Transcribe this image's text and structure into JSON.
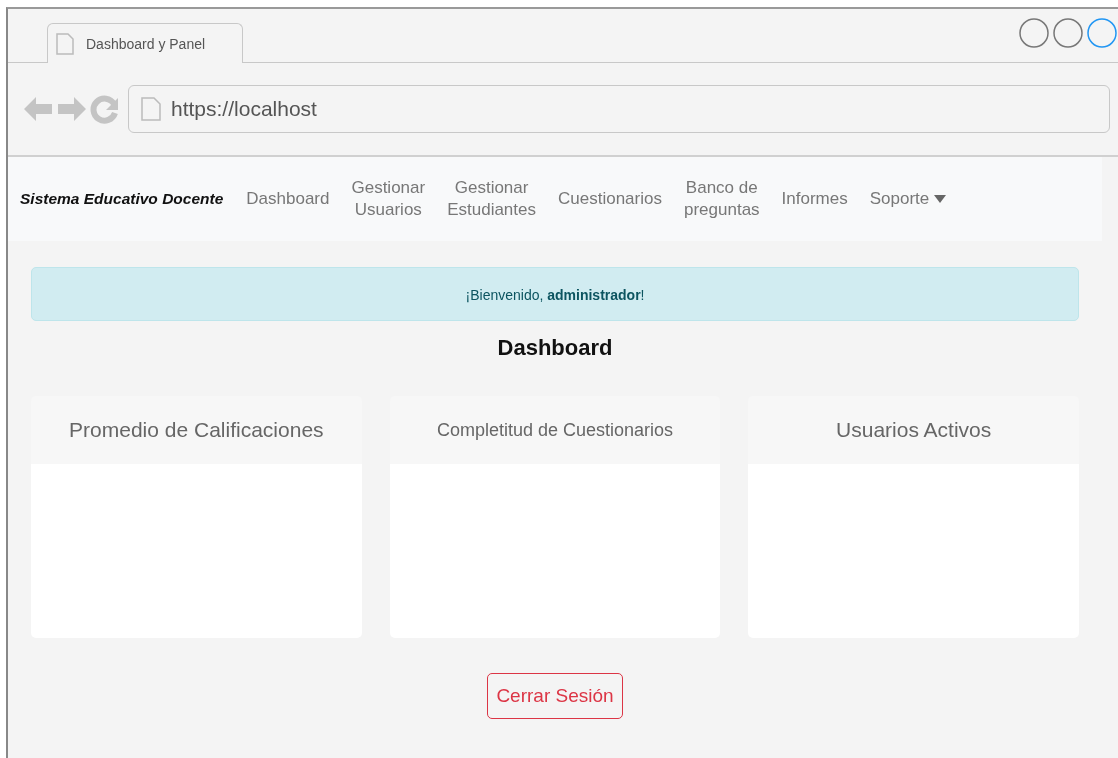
{
  "browser": {
    "tab_title": "Dashboard y Panel",
    "url": "https://localhost"
  },
  "navbar": {
    "brand": "Sistema Educativo Docente",
    "items": [
      {
        "label": "Dashboard",
        "kind": "link"
      },
      {
        "label": "Gestionar\nUsuarios",
        "kind": "link"
      },
      {
        "label": "Gestionar\nEstudiantes",
        "kind": "link"
      },
      {
        "label": "Cuestionarios",
        "kind": "link"
      },
      {
        "label": "Banco de\npreguntas",
        "kind": "link"
      },
      {
        "label": "Informes",
        "kind": "link"
      },
      {
        "label": "Soporte",
        "kind": "dropdown"
      }
    ]
  },
  "alert": "¡Bienvenido, **administrador**!",
  "heading": "Dashboard",
  "cards": [
    {
      "title": "Promedio de Calificaciones"
    },
    {
      "title": "Completitud de Cuestionarios"
    },
    {
      "title": "Usuarios Activos"
    }
  ],
  "logout_button": "Cerrar Sesión"
}
